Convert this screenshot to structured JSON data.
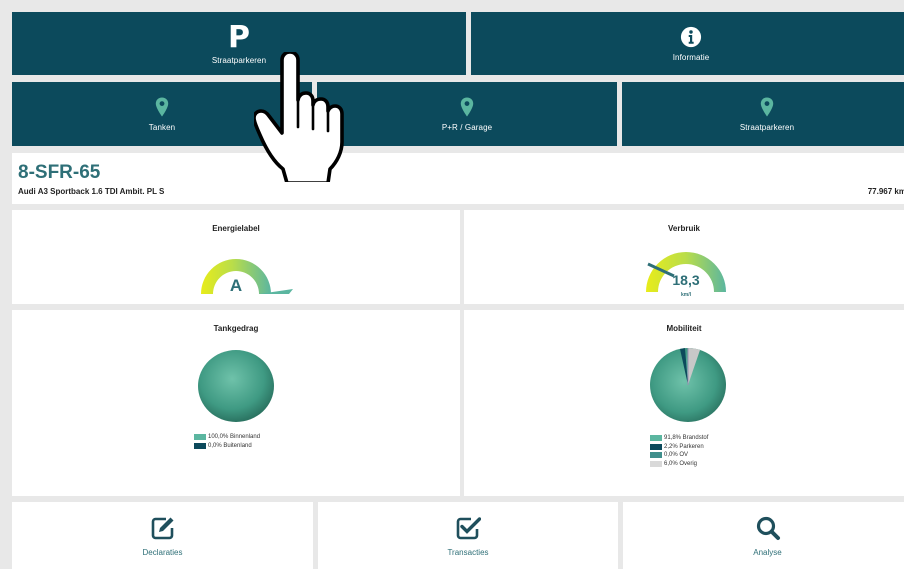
{
  "top_nav": {
    "straatparkeren": {
      "symbol": "P",
      "label": "Straatparkeren",
      "icon": "parking-p-icon"
    },
    "informatie": {
      "label": "Informatie",
      "icon": "info-circle-icon"
    }
  },
  "locations": [
    {
      "label": "Tanken",
      "icon": "map-pin-icon"
    },
    {
      "label": "P+R / Garage",
      "icon": "map-pin-icon"
    },
    {
      "label": "Straatparkeren",
      "icon": "map-pin-icon"
    }
  ],
  "vehicle": {
    "plate": "8-SFR-65",
    "model": "Audi A3 Sportback 1.6 TDI Ambit. PL S",
    "mileage": "77.967 km"
  },
  "energy_label": {
    "title": "Energielabel",
    "value": "A"
  },
  "consumption": {
    "title": "Verbruik",
    "value": "18,3",
    "unit": "km/l"
  },
  "tank_behavior": {
    "title": "Tankgedrag",
    "legend": [
      {
        "label": "100,0% Binnenland",
        "color": "#5bb6a0"
      },
      {
        "label": "0,0% Buitenland",
        "color": "#0c4a5c"
      }
    ]
  },
  "mobility": {
    "title": "Mobiliteit",
    "legend": [
      {
        "label": "91,8% Brandstof",
        "color": "#5bb6a0"
      },
      {
        "label": "2,2% Parkeren",
        "color": "#0c4a5c"
      },
      {
        "label": "0,0% OV",
        "color": "#3f8f8c"
      },
      {
        "label": "6,0% Overig",
        "color": "#d9d9d9"
      }
    ]
  },
  "bottom_nav": [
    {
      "label": "Declaraties",
      "icon": "edit-icon"
    },
    {
      "label": "Transacties",
      "icon": "checkbox-icon"
    },
    {
      "label": "Analyse",
      "icon": "search-icon"
    }
  ],
  "colors": {
    "primary": "#0c4a5c",
    "accent": "#2e6f77",
    "chart_green": "#5bb6a0",
    "background": "#e8e8e8"
  }
}
